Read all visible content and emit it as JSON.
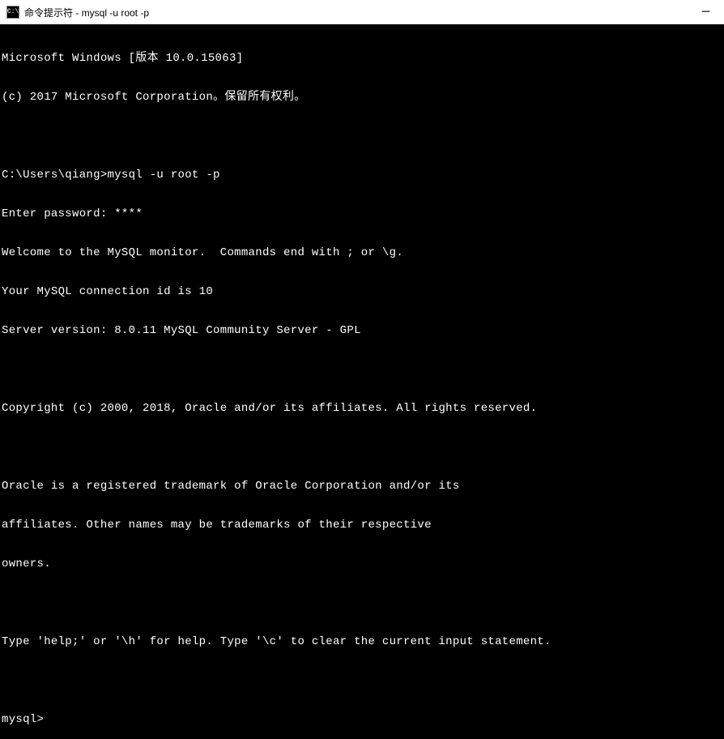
{
  "window": {
    "icon_label": "C:\\",
    "title": "命令提示符 - mysql  -u root -p"
  },
  "terminal": {
    "lines": [
      "Microsoft Windows [版本 10.0.15063]",
      "(c) 2017 Microsoft Corporation。保留所有权利。",
      "",
      "C:\\Users\\qiang>mysql -u root -p",
      "Enter password: ****",
      "Welcome to the MySQL monitor.  Commands end with ; or \\g.",
      "Your MySQL connection id is 10",
      "Server version: 8.0.11 MySQL Community Server - GPL",
      "",
      "Copyright (c) 2000, 2018, Oracle and/or its affiliates. All rights reserved.",
      "",
      "Oracle is a registered trademark of Oracle Corporation and/or its",
      "affiliates. Other names may be trademarks of their respective",
      "owners.",
      "",
      "Type 'help;' or '\\h' for help. Type '\\c' to clear the current input statement.",
      "",
      "mysql>"
    ]
  }
}
